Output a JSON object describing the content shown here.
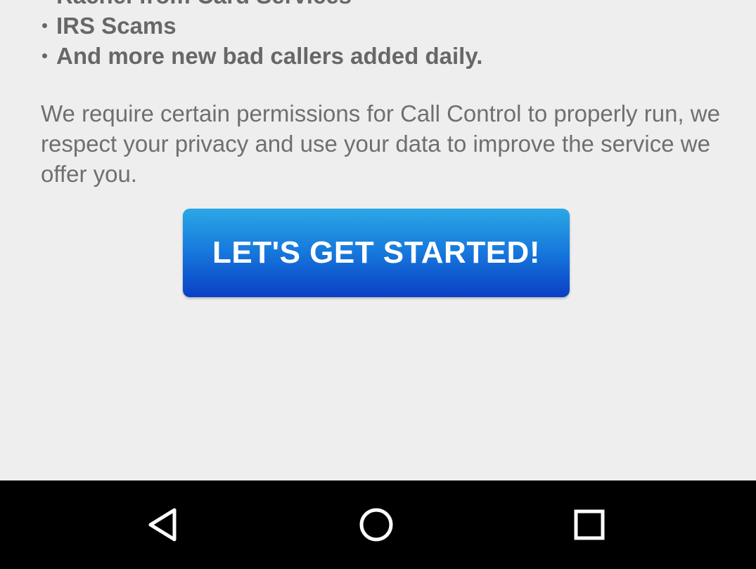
{
  "intro": {
    "bullets": [
      "Rachel from Card Services",
      "IRS Scams",
      "And more new bad callers added daily."
    ],
    "permissions_text": "We require certain permissions for Call Control to properly run, we respect your privacy and use your data to improve the service we offer you."
  },
  "start_button": {
    "label": "LET'S GET STARTED!"
  },
  "navbar": {
    "back_icon": "back-triangle-icon",
    "home_icon": "home-circle-icon",
    "recents_icon": "recents-square-icon"
  },
  "colors": {
    "background": "#eeeeee",
    "text": "#676767",
    "button_top": "#2aa7e6",
    "button_bottom": "#0a3fc4",
    "navbar": "#000000"
  }
}
